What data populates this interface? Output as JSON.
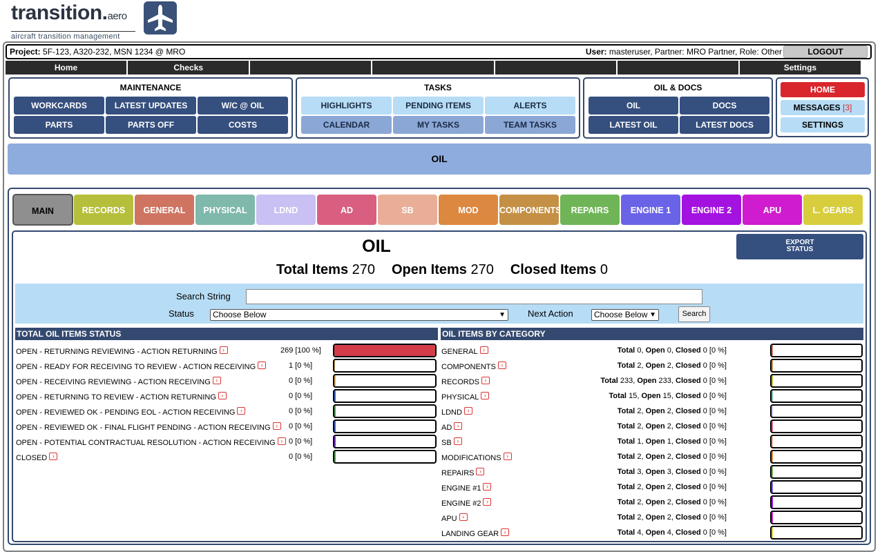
{
  "header": {
    "brand": "transition.",
    "brand_suffix": "aero",
    "tagline": "aircraft transition management"
  },
  "project": {
    "label": "Project:",
    "value": "5F-123, A320-232, MSN 1234 @ MRO",
    "user_label": "User:",
    "user_value": "masteruser, Partner: MRO Partner, Role: Other",
    "logout": "LOGOUT"
  },
  "nav": [
    "Home",
    "Checks",
    "",
    "",
    "",
    "",
    "Settings"
  ],
  "maintenance": {
    "title": "MAINTENANCE",
    "buttons": [
      "WORKCARDS",
      "LATEST UPDATES",
      "W/C @ OIL",
      "PARTS",
      "PARTS OFF",
      "COSTS"
    ]
  },
  "tasks": {
    "title": "TASKS",
    "buttons": [
      "HIGHLIGHTS",
      "PENDING ITEMS",
      "ALERTS",
      "CALENDAR",
      "MY TASKS",
      "TEAM TASKS"
    ]
  },
  "oil_docs": {
    "title": "OIL & DOCS",
    "buttons": [
      "OIL",
      "DOCS",
      "LATEST OIL",
      "LATEST DOCS"
    ]
  },
  "side": {
    "home": "HOME",
    "messages": "MESSAGES",
    "messages_count": "[3]",
    "settings": "SETTINGS"
  },
  "banner": "OIL",
  "tabs": [
    {
      "label": "MAIN",
      "color": "#8f8f8f"
    },
    {
      "label": "RECORDS",
      "color": "#b6bf3b"
    },
    {
      "label": "GENERAL",
      "color": "#cf7461"
    },
    {
      "label": "PHYSICAL",
      "color": "#7fb9ab"
    },
    {
      "label": "LDND",
      "color": "#c9c0f3"
    },
    {
      "label": "AD",
      "color": "#d95f81"
    },
    {
      "label": "SB",
      "color": "#e8ae97"
    },
    {
      "label": "MOD",
      "color": "#dd8840"
    },
    {
      "label": "COMPONENTS",
      "color": "#c49045"
    },
    {
      "label": "REPAIRS",
      "color": "#6fb557"
    },
    {
      "label": "ENGINE 1",
      "color": "#6a63e8"
    },
    {
      "label": "ENGINE 2",
      "color": "#a412e0"
    },
    {
      "label": "APU",
      "color": "#cf1ccf"
    },
    {
      "label": "L. GEARS",
      "color": "#d8ce3d"
    }
  ],
  "oil": {
    "title": "OIL",
    "export": "EXPORT\nSTATUS",
    "export_line1": "EXPORT",
    "export_line2": "STATUS",
    "total_label": "Total Items",
    "total": "270",
    "open_label": "Open Items",
    "open": "270",
    "closed_label": "Closed Items",
    "closed": "0"
  },
  "search": {
    "string_label": "Search String",
    "status_label": "Status",
    "status_value": "Choose Below",
    "next_label": "Next Action",
    "next_value": "Choose Below",
    "button": "Search"
  },
  "status_section": {
    "title": "TOTAL OIL ITEMS STATUS",
    "rows": [
      {
        "label": "OPEN - RETURNING REVIEWING - ACTION RETURNING",
        "value": "269 [100 %]",
        "pct": 100,
        "color": "#d33c48"
      },
      {
        "label": "OPEN - READY FOR RECEIVING TO REVIEW - ACTION RECEIVING",
        "value": "1 [0 %]",
        "pct": 0.4,
        "color": "#e3a857"
      },
      {
        "label": "OPEN - RECEIVING REVIEWING - ACTION RECEIVING",
        "value": "0 [0 %]",
        "pct": 0,
        "color": "#e3a857"
      },
      {
        "label": "OPEN - RETURNING TO REVIEW - ACTION RETURNING",
        "value": "0 [0 %]",
        "pct": 0,
        "color": "#3a6bd6"
      },
      {
        "label": "OPEN - REVIEWED OK - PENDING EOL - ACTION RECEIVING",
        "value": "0 [0 %]",
        "pct": 0,
        "color": "#4aa34a"
      },
      {
        "label": "OPEN - REVIEWED OK - FINAL FLIGHT PENDING - ACTION RECEIVING",
        "value": "0 [0 %]",
        "pct": 0,
        "color": "#3a6bd6"
      },
      {
        "label": "OPEN - POTENTIAL CONTRACTUAL RESOLUTION - ACTION RECEIVING",
        "value": "0 [0 %]",
        "pct": 0,
        "color": "#8a2be2"
      },
      {
        "label": "CLOSED",
        "value": "0 [0 %]",
        "pct": 0,
        "color": "#4aa34a"
      }
    ]
  },
  "category_section": {
    "title": "OIL ITEMS BY CATEGORY",
    "rows": [
      {
        "label": "GENERAL",
        "total": "0",
        "open": "0",
        "closed": "0 [0 %]",
        "color": "#cf7461"
      },
      {
        "label": "COMPONENTS",
        "total": "2",
        "open": "2",
        "closed": "0 [0 %]",
        "color": "#c49045"
      },
      {
        "label": "RECORDS",
        "total": "233",
        "open": "233",
        "closed": "0 [0 %]",
        "color": "#b6bf3b"
      },
      {
        "label": "PHYSICAL",
        "total": "15",
        "open": "15",
        "closed": "0 [0 %]",
        "color": "#7fb9ab"
      },
      {
        "label": "LDND",
        "total": "2",
        "open": "2",
        "closed": "0 [0 %]",
        "color": "#c9c0f3"
      },
      {
        "label": "AD",
        "total": "2",
        "open": "2",
        "closed": "0 [0 %]",
        "color": "#d95f81"
      },
      {
        "label": "SB",
        "total": "1",
        "open": "1",
        "closed": "0 [0 %]",
        "color": "#e8ae97"
      },
      {
        "label": "MODIFICATIONS",
        "total": "2",
        "open": "2",
        "closed": "0 [0 %]",
        "color": "#dd8840"
      },
      {
        "label": "REPAIRS",
        "total": "3",
        "open": "3",
        "closed": "0 [0 %]",
        "color": "#6fb557"
      },
      {
        "label": "ENGINE #1",
        "total": "2",
        "open": "2",
        "closed": "0 [0 %]",
        "color": "#6a63e8"
      },
      {
        "label": "ENGINE #2",
        "total": "2",
        "open": "2",
        "closed": "0 [0 %]",
        "color": "#a412e0"
      },
      {
        "label": "APU",
        "total": "2",
        "open": "2",
        "closed": "0 [0 %]",
        "color": "#cf1ccf"
      },
      {
        "label": "LANDING GEAR",
        "total": "4",
        "open": "4",
        "closed": "0 [0 %]",
        "color": "#d8ce3d"
      }
    ],
    "total_word": "Total",
    "open_word": "Open",
    "closed_word": "Closed"
  }
}
